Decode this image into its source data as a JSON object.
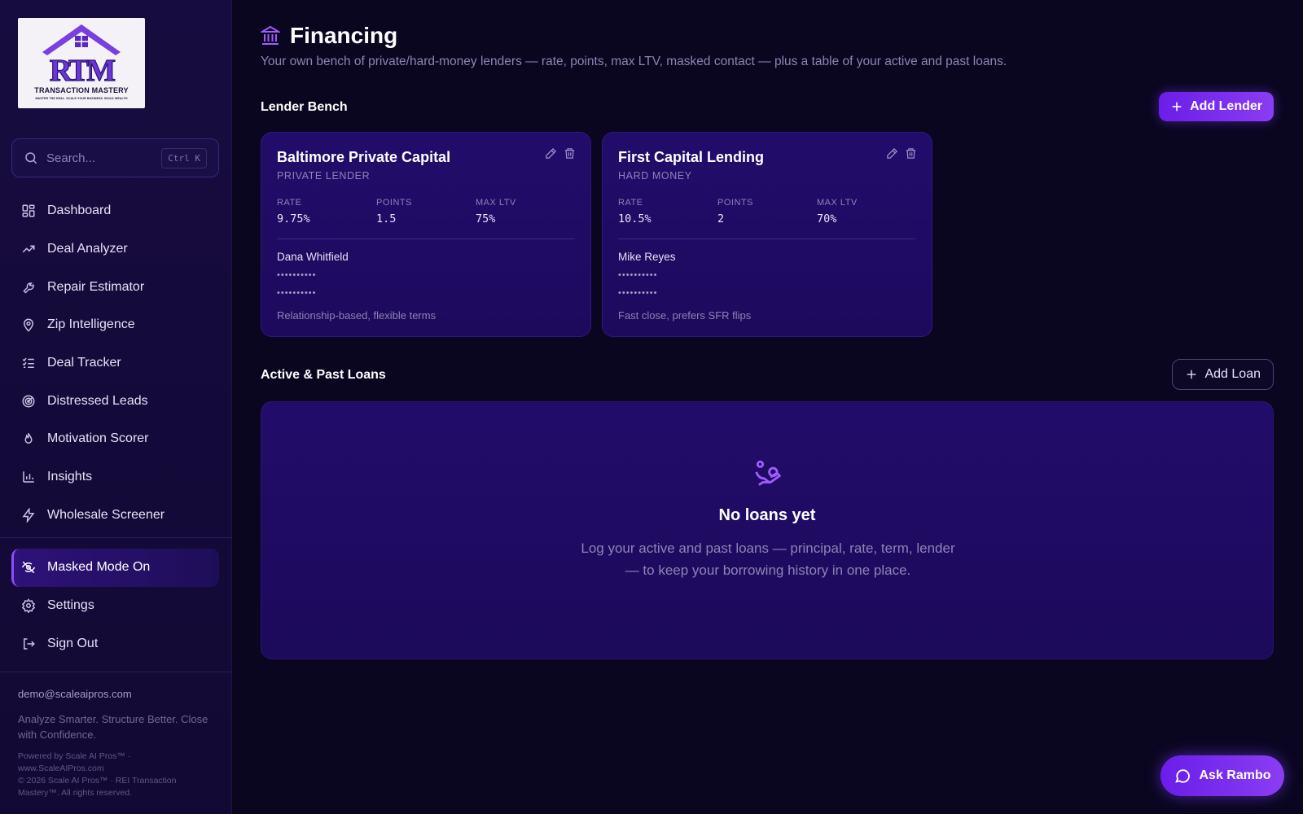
{
  "sidebar": {
    "logo": {
      "title": "TRANSACTION MASTERY",
      "tagline": "MASTER THE DEAL. SCALE YOUR BUSINESS. BUILD WEALTH",
      "monogram": "RTM"
    },
    "search": {
      "placeholder": "Search...",
      "shortcut": "Ctrl K"
    },
    "nav": [
      {
        "label": "Dashboard",
        "icon": "grid-icon"
      },
      {
        "label": "Deal Analyzer",
        "icon": "trending-up-icon"
      },
      {
        "label": "Repair Estimator",
        "icon": "wrench-icon"
      },
      {
        "label": "Zip Intelligence",
        "icon": "map-pin-icon"
      },
      {
        "label": "Deal Tracker",
        "icon": "list-checks-icon"
      },
      {
        "label": "Distressed Leads",
        "icon": "radar-icon"
      },
      {
        "label": "Motivation Scorer",
        "icon": "flame-icon"
      },
      {
        "label": "Insights",
        "icon": "bar-chart-icon"
      },
      {
        "label": "Wholesale Screener",
        "icon": "zap-icon"
      }
    ],
    "secondary_nav": [
      {
        "label": "Masked Mode On",
        "icon": "eye-off-icon",
        "active": true
      },
      {
        "label": "Settings",
        "icon": "gear-icon"
      },
      {
        "label": "Sign Out",
        "icon": "sign-out-icon"
      }
    ],
    "footer": {
      "email": "demo@scaleaipros.com",
      "tagline": "Analyze Smarter. Structure Better. Close with Confidence.",
      "powered": "Powered by Scale AI Pros™ · www.ScaleAIPros.com",
      "copyright": "© 2026 Scale AI Pros™ · REI Transaction Mastery™. All rights reserved."
    }
  },
  "page": {
    "icon": "bank-icon",
    "title": "Financing",
    "subtitle": "Your own bench of private/hard-money lenders — rate, points, max LTV, masked contact — plus a table of your active and past loans."
  },
  "lender_bench": {
    "title": "Lender Bench",
    "add_label": "Add Lender",
    "stat_labels": {
      "rate": "RATE",
      "points": "POINTS",
      "max_ltv": "MAX LTV"
    },
    "lenders": [
      {
        "name": "Baltimore Private Capital",
        "type": "PRIVATE LENDER",
        "rate": "9.75%",
        "points": "1.5",
        "max_ltv": "75%",
        "contact": "Dana Whitfield",
        "phone_masked": "••••••••••",
        "email_masked": "••••••••••",
        "note": "Relationship-based, flexible terms"
      },
      {
        "name": "First Capital Lending",
        "type": "HARD MONEY",
        "rate": "10.5%",
        "points": "2",
        "max_ltv": "70%",
        "contact": "Mike Reyes",
        "phone_masked": "••••••••••",
        "email_masked": "••••••••••",
        "note": "Fast close, prefers SFR flips"
      }
    ]
  },
  "loans": {
    "title": "Active & Past Loans",
    "add_label": "Add Loan",
    "empty_title": "No loans yet",
    "empty_text": "Log your active and past loans — principal, rate, term, lender — to keep your borrowing history in one place."
  },
  "assistant": {
    "label": "Ask Rambo"
  },
  "colors": {
    "accent": "#8a3df2",
    "background": "#0a0620",
    "sidebar": "#170c3f",
    "card": "#220c6b"
  }
}
